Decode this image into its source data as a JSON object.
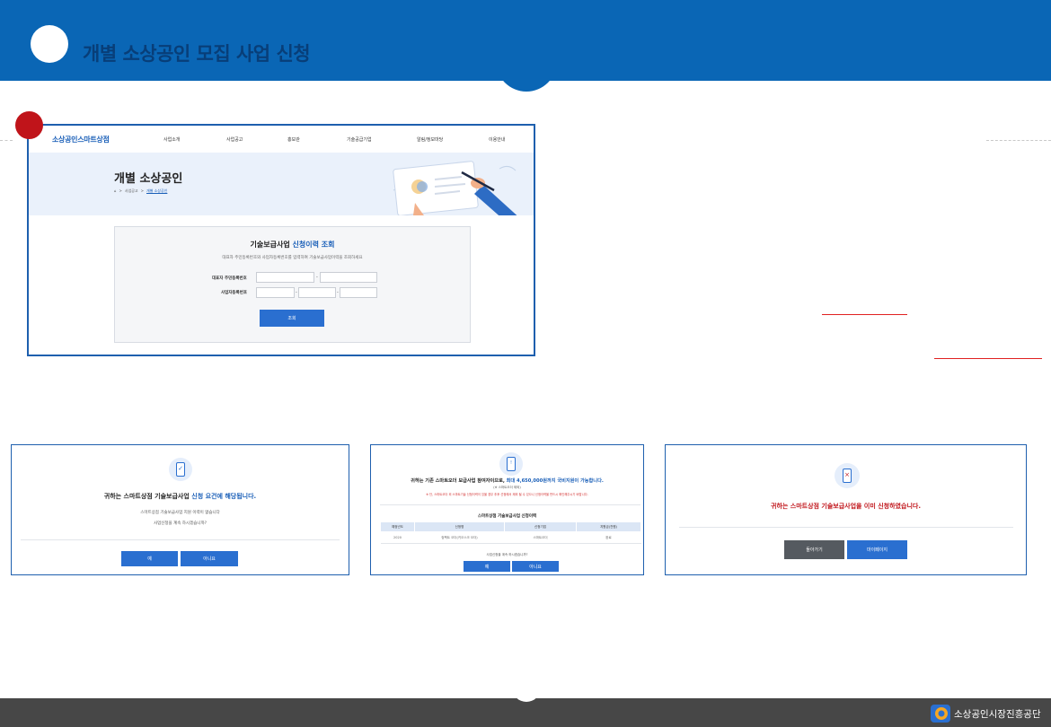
{
  "header": {
    "title": "개별 소상공인 모집 사업 신청"
  },
  "portal": {
    "logo": "소상공인스마트상점",
    "nav": [
      "사업소개",
      "사업공고",
      "홍보관",
      "기술공급기업",
      "알림/정보마당",
      "이용안내"
    ],
    "hero_title": "개별 소상공인",
    "breadcrumbs": [
      "사업공고",
      "개별 소상공인"
    ],
    "lookup": {
      "title_prefix": "기술보급사업",
      "title_highlight": "신청이력 조회",
      "description": "대표자 주민등록번호와 사업자등록번호를 입력하여 기술보급사업이력을 조회하세요",
      "rrn_label": "대표자 주민등록번호",
      "brn_label": "사업자등록번호",
      "dash": "-",
      "button": "조회"
    }
  },
  "dialog_eligible": {
    "head_prefix": "귀하는 스마트상점 기술보급사업",
    "head_highlight": "신청 요건에 해당됩니다.",
    "line1": "스마트상점 기술보급사업 지원 이력이 없습니다",
    "line2": "사업신청을 계속 하시겠습니까?",
    "yes": "예",
    "no": "아니요"
  },
  "dialog_history": {
    "head_prefix": "귀하는 기존 스마트오더 보급사업 참여자이므로,",
    "head_highlight": "최대 4,650,000원까지 국비지원이 가능합니다.",
    "paren": "(※ 스마트오더 제외)",
    "warning": "※ 단, 스마트오더 외 스마트기술 신청이력이 있을 경우 추후 선정에서 제외 될 수 있으니 신청이력을 반드시 확인해주시기 바랍니다.",
    "table_title": "스마트상점 기술보급사업 신청이력",
    "columns": [
      "예정년도",
      "신청명",
      "신청기업",
      "지원금(천원)"
    ],
    "row": [
      "2020",
      "컴팩트 오더(키오스크 오더)",
      "스마트오더",
      "완료"
    ],
    "prompt": "사업신청을 계속 하시겠습니까?",
    "yes": "예",
    "no": "아니요"
  },
  "dialog_already": {
    "head_prefix": "귀하는 스마트상점 기술보급사업을",
    "head_highlight": "이미 신청하였습니다.",
    "back": "돌아가기",
    "mypage": "마이페이지"
  },
  "footer": {
    "org": "소상공인시장진흥공단"
  },
  "colors": {
    "brand_blue": "#0a66b5",
    "accent_red": "#c0141a",
    "button_blue": "#2a6fd0",
    "footer_gray": "#474747"
  }
}
